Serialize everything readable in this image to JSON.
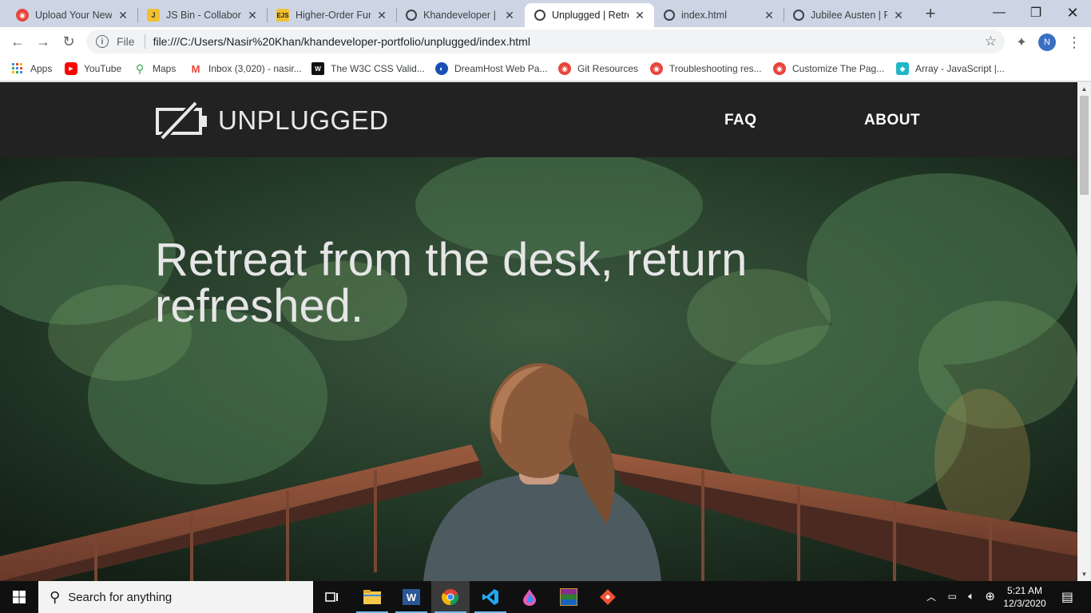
{
  "browser": {
    "tabs": [
      {
        "title": "Upload Your New",
        "icon": "red-logo-icon",
        "active": false
      },
      {
        "title": "JS Bin - Collaborat",
        "icon": "jsbin-icon",
        "active": false
      },
      {
        "title": "Higher-Order Func",
        "icon": "ejs-icon",
        "active": false
      },
      {
        "title": "Khandeveloper | Po",
        "icon": "globe-icon",
        "active": false
      },
      {
        "title": "Unplugged | Retre",
        "icon": "globe-icon",
        "active": true
      },
      {
        "title": "index.html",
        "icon": "globe-icon",
        "active": false
      },
      {
        "title": "Jubilee Austen | Po",
        "icon": "globe-icon",
        "active": false
      }
    ],
    "address": {
      "scheme": "File",
      "url": "file:///C:/Users/Nasir%20Khan/khandeveloper-portfolio/unplugged/index.html"
    },
    "bookmarks": [
      {
        "label": "Apps",
        "icon": "apps-grid-icon"
      },
      {
        "label": "YouTube",
        "icon": "youtube-icon"
      },
      {
        "label": "Maps",
        "icon": "maps-pin-icon"
      },
      {
        "label": "Inbox (3,020) - nasir...",
        "icon": "gmail-icon"
      },
      {
        "label": "The W3C CSS Valid...",
        "icon": "w3c-icon"
      },
      {
        "label": "DreamHost Web Pa...",
        "icon": "dreamhost-icon"
      },
      {
        "label": "Git Resources",
        "icon": "red-logo-icon"
      },
      {
        "label": "Troubleshooting res...",
        "icon": "red-logo-icon"
      },
      {
        "label": "Customize The Pag...",
        "icon": "red-logo-icon"
      },
      {
        "label": "Array - JavaScript |...",
        "icon": "mdn-icon"
      }
    ]
  },
  "site": {
    "logo_text": "UNPLUGGED",
    "nav": [
      "FAQ",
      "ABOUT"
    ],
    "hero_heading": "Retreat from the desk, return refreshed."
  },
  "taskbar": {
    "search_placeholder": "Search for anything",
    "time": "5:21 AM",
    "date": "12/3/2020"
  },
  "colors": {
    "site_header": "#222222",
    "hero_text": "#e6e6e6",
    "tab_strip": "#cdd5e4",
    "taskbar": "#101010"
  }
}
